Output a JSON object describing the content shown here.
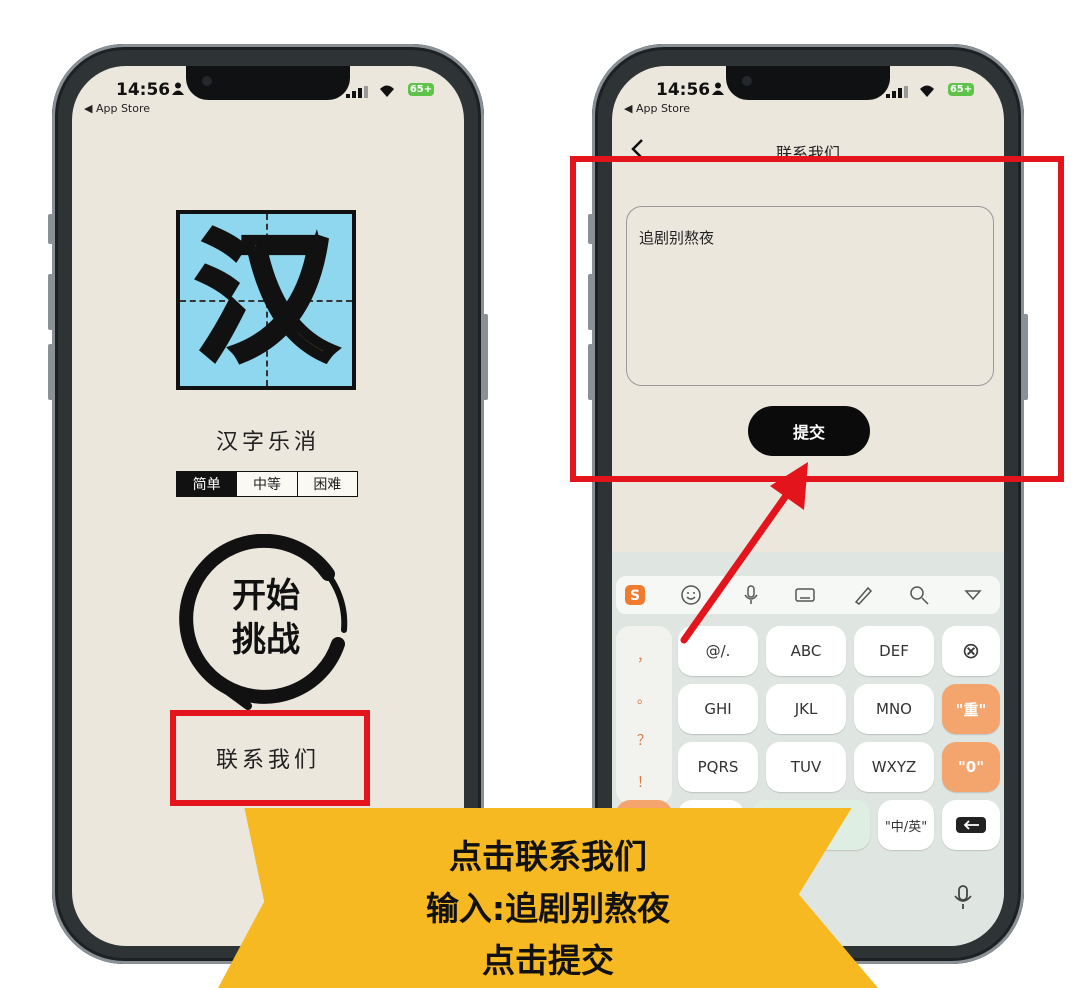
{
  "status": {
    "time": "14:56",
    "back_app": "◀ App Store",
    "battery": "65+"
  },
  "home": {
    "logo_char": "汉",
    "app_title": "汉字乐消",
    "difficulty": [
      "简单",
      "中等",
      "困难"
    ],
    "start_button": "开始\n挑战",
    "contact_link": "联系我们"
  },
  "contact_page": {
    "title": "联系我们",
    "feedback_value": "追剧别熬夜",
    "submit_label": "提交"
  },
  "keyboard": {
    "punct": [
      "，",
      "。",
      "？",
      "！"
    ],
    "row1": [
      "@/.",
      "ABC",
      "DEF"
    ],
    "row2": [
      "GHI",
      "JKL",
      "MNO"
    ],
    "row3": [
      "PQRS",
      "TUV",
      "WXYZ"
    ],
    "right_keys": [
      "⊗",
      "\"重\"",
      "\"0\""
    ],
    "lang_key": "\"中/英\""
  },
  "banner": {
    "line1": "点击联系我们",
    "line2": "输入:追剧别熬夜",
    "line3": "点击提交"
  },
  "colors": {
    "highlight": "#e3141c",
    "banner": "#f7b922",
    "logo_bg": "#8fd7ef"
  }
}
